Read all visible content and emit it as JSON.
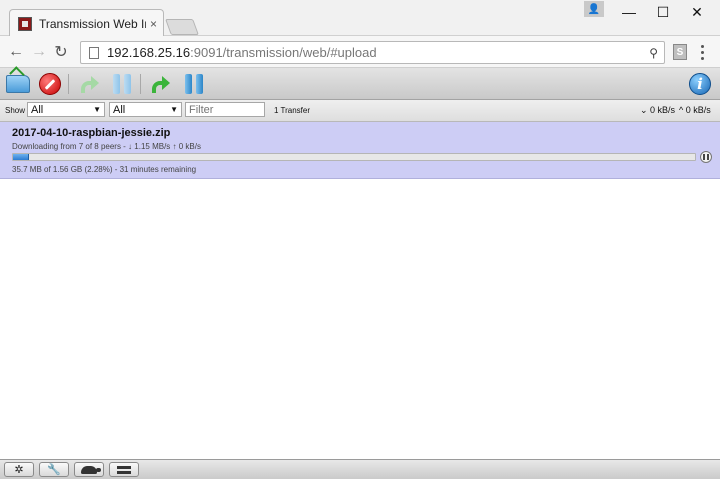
{
  "browser": {
    "tab_title": "Transmission Web Inter",
    "tab_close": "×",
    "url_host": "192.168.25.16",
    "url_path": ":9091/transmission/web/#upload",
    "ext_label": "S",
    "controls": {
      "back": "←",
      "forward": "→",
      "reload": "↻",
      "minimize": "—",
      "maximize": "☐",
      "close": "✕",
      "user": "👤"
    }
  },
  "toolbar": {
    "icons": [
      "open-torrent-icon",
      "remove-torrent-icon",
      "resume-icon",
      "pause-icon",
      "resume-all-icon",
      "pause-all-icon",
      "info-icon"
    ],
    "info_label": "i"
  },
  "filter": {
    "show_label": "Show",
    "state_value": "All",
    "tracker_value": "All",
    "filter_placeholder": "Filter",
    "transfer_count": "1 Transfer",
    "download_speed": "⌄ 0 kB/s",
    "upload_speed": "^ 0 kB/s"
  },
  "torrents": [
    {
      "name": "2017-04-10-raspbian-jessie.zip",
      "peers": "Downloading from 7 of 8 peers - ↓ 1.15 MB/s ↑ 0 kB/s",
      "details": "35.7 MB of 1.56 GB (2.28%) - 31 minutes remaining",
      "progress_percent": 2.28
    }
  ],
  "footer": {
    "settings_label": "✲",
    "prefs_label": "🔧"
  },
  "colors": {
    "selected_row": "#cdcdf5",
    "progress_fill": "#2c7cd2",
    "remove": "#c50000",
    "resume": "#3bb43b"
  }
}
